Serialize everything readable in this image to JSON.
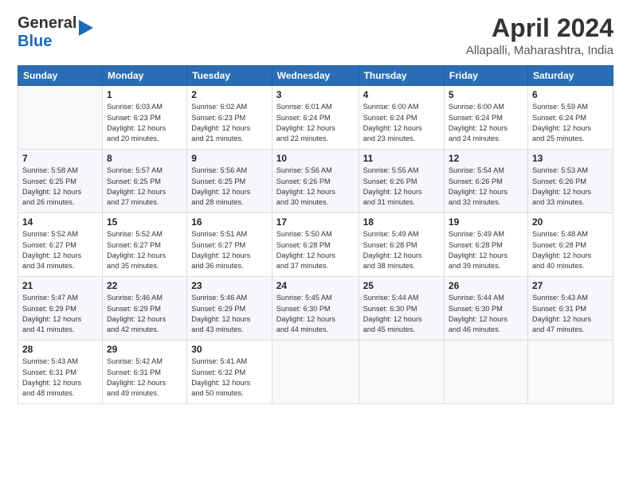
{
  "header": {
    "logo_line1": "General",
    "logo_line2": "Blue",
    "title": "April 2024",
    "subtitle": "Allapalli, Maharashtra, India"
  },
  "weekdays": [
    "Sunday",
    "Monday",
    "Tuesday",
    "Wednesday",
    "Thursday",
    "Friday",
    "Saturday"
  ],
  "weeks": [
    [
      {
        "num": "",
        "info": ""
      },
      {
        "num": "1",
        "info": "Sunrise: 6:03 AM\nSunset: 6:23 PM\nDaylight: 12 hours\nand 20 minutes."
      },
      {
        "num": "2",
        "info": "Sunrise: 6:02 AM\nSunset: 6:23 PM\nDaylight: 12 hours\nand 21 minutes."
      },
      {
        "num": "3",
        "info": "Sunrise: 6:01 AM\nSunset: 6:24 PM\nDaylight: 12 hours\nand 22 minutes."
      },
      {
        "num": "4",
        "info": "Sunrise: 6:00 AM\nSunset: 6:24 PM\nDaylight: 12 hours\nand 23 minutes."
      },
      {
        "num": "5",
        "info": "Sunrise: 6:00 AM\nSunset: 6:24 PM\nDaylight: 12 hours\nand 24 minutes."
      },
      {
        "num": "6",
        "info": "Sunrise: 5:59 AM\nSunset: 6:24 PM\nDaylight: 12 hours\nand 25 minutes."
      }
    ],
    [
      {
        "num": "7",
        "info": "Sunrise: 5:58 AM\nSunset: 6:25 PM\nDaylight: 12 hours\nand 26 minutes."
      },
      {
        "num": "8",
        "info": "Sunrise: 5:57 AM\nSunset: 6:25 PM\nDaylight: 12 hours\nand 27 minutes."
      },
      {
        "num": "9",
        "info": "Sunrise: 5:56 AM\nSunset: 6:25 PM\nDaylight: 12 hours\nand 28 minutes."
      },
      {
        "num": "10",
        "info": "Sunrise: 5:56 AM\nSunset: 6:26 PM\nDaylight: 12 hours\nand 30 minutes."
      },
      {
        "num": "11",
        "info": "Sunrise: 5:55 AM\nSunset: 6:26 PM\nDaylight: 12 hours\nand 31 minutes."
      },
      {
        "num": "12",
        "info": "Sunrise: 5:54 AM\nSunset: 6:26 PM\nDaylight: 12 hours\nand 32 minutes."
      },
      {
        "num": "13",
        "info": "Sunrise: 5:53 AM\nSunset: 6:26 PM\nDaylight: 12 hours\nand 33 minutes."
      }
    ],
    [
      {
        "num": "14",
        "info": "Sunrise: 5:52 AM\nSunset: 6:27 PM\nDaylight: 12 hours\nand 34 minutes."
      },
      {
        "num": "15",
        "info": "Sunrise: 5:52 AM\nSunset: 6:27 PM\nDaylight: 12 hours\nand 35 minutes."
      },
      {
        "num": "16",
        "info": "Sunrise: 5:51 AM\nSunset: 6:27 PM\nDaylight: 12 hours\nand 36 minutes."
      },
      {
        "num": "17",
        "info": "Sunrise: 5:50 AM\nSunset: 6:28 PM\nDaylight: 12 hours\nand 37 minutes."
      },
      {
        "num": "18",
        "info": "Sunrise: 5:49 AM\nSunset: 6:28 PM\nDaylight: 12 hours\nand 38 minutes."
      },
      {
        "num": "19",
        "info": "Sunrise: 5:49 AM\nSunset: 6:28 PM\nDaylight: 12 hours\nand 39 minutes."
      },
      {
        "num": "20",
        "info": "Sunrise: 5:48 AM\nSunset: 6:28 PM\nDaylight: 12 hours\nand 40 minutes."
      }
    ],
    [
      {
        "num": "21",
        "info": "Sunrise: 5:47 AM\nSunset: 6:29 PM\nDaylight: 12 hours\nand 41 minutes."
      },
      {
        "num": "22",
        "info": "Sunrise: 5:46 AM\nSunset: 6:29 PM\nDaylight: 12 hours\nand 42 minutes."
      },
      {
        "num": "23",
        "info": "Sunrise: 5:46 AM\nSunset: 6:29 PM\nDaylight: 12 hours\nand 43 minutes."
      },
      {
        "num": "24",
        "info": "Sunrise: 5:45 AM\nSunset: 6:30 PM\nDaylight: 12 hours\nand 44 minutes."
      },
      {
        "num": "25",
        "info": "Sunrise: 5:44 AM\nSunset: 6:30 PM\nDaylight: 12 hours\nand 45 minutes."
      },
      {
        "num": "26",
        "info": "Sunrise: 5:44 AM\nSunset: 6:30 PM\nDaylight: 12 hours\nand 46 minutes."
      },
      {
        "num": "27",
        "info": "Sunrise: 5:43 AM\nSunset: 6:31 PM\nDaylight: 12 hours\nand 47 minutes."
      }
    ],
    [
      {
        "num": "28",
        "info": "Sunrise: 5:43 AM\nSunset: 6:31 PM\nDaylight: 12 hours\nand 48 minutes."
      },
      {
        "num": "29",
        "info": "Sunrise: 5:42 AM\nSunset: 6:31 PM\nDaylight: 12 hours\nand 49 minutes."
      },
      {
        "num": "30",
        "info": "Sunrise: 5:41 AM\nSunset: 6:32 PM\nDaylight: 12 hours\nand 50 minutes."
      },
      {
        "num": "",
        "info": ""
      },
      {
        "num": "",
        "info": ""
      },
      {
        "num": "",
        "info": ""
      },
      {
        "num": "",
        "info": ""
      }
    ]
  ]
}
